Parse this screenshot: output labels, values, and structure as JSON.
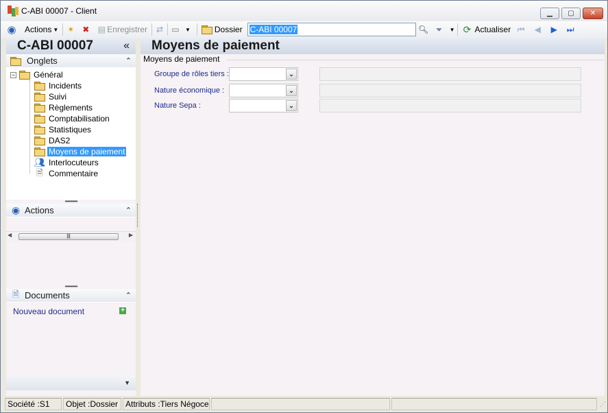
{
  "window": {
    "title": "C-ABI 00007 -  Client"
  },
  "toolbar": {
    "actions_label": "Actions",
    "save_label": "Enregistrer",
    "dossier_label": "Dossier",
    "dossier_value": "C-ABI 00007",
    "refresh_label": "Actualiser"
  },
  "left": {
    "header": "C-ABI 00007",
    "tabs_title": "Onglets",
    "tree": {
      "root": "Général",
      "items": [
        "Incidents",
        "Suivi",
        "Règlements",
        "Comptabilisation",
        "Statistiques",
        "DAS2",
        "Moyens de paiement",
        "Interlocuteurs",
        "Commentaire"
      ],
      "selected": "Moyens de paiement"
    },
    "actions_title": "Actions",
    "documents_title": "Documents",
    "new_document": "Nouveau document"
  },
  "main": {
    "header": "Moyens de paiement",
    "group_title": "Moyens de paiement",
    "fields": [
      {
        "label": "Groupe de rôles tiers :",
        "value": ""
      },
      {
        "label": "Nature économique :",
        "value": ""
      },
      {
        "label": "Nature Sepa :",
        "value": ""
      }
    ]
  },
  "status": {
    "societe": "Société :S1",
    "objet": "Objet :Dossier",
    "attributs": "Attributs :Tiers Négoce"
  },
  "colors": {
    "selection": "#3399ff",
    "label_blue": "#1e2a8c",
    "panel_bg": "#f6f2f5"
  }
}
